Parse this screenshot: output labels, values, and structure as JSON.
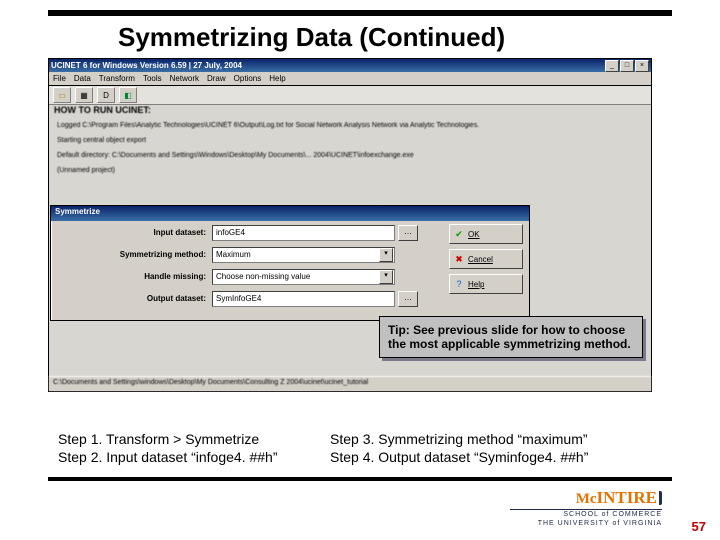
{
  "slide": {
    "title": "Symmetrizing Data (Continued)",
    "page_number": "57"
  },
  "app": {
    "title": "UCINET 6 for Windows    Version 6.59  |  27 July, 2004",
    "menus": [
      "File",
      "Data",
      "Transform",
      "Tools",
      "Network",
      "Draw",
      "Options",
      "Help"
    ],
    "header_line": "HOW TO RUN UCINET:",
    "fuzz_1": "Logged C:\\Program Files\\Analytic Technologies\\UCINET 6\\Output\\Log.txt for Social Network Analysis Network via Analytic Technologies.",
    "fuzz_2": "Starting central object export",
    "fuzz_3": "Default directory: C:\\Documents and Settings\\Windows\\Desktop\\My Documents\\... 2004\\UCINET\\infoexchange.exe",
    "fuzz_4": "(Unnamed project)",
    "status": "C:\\Documents and Settings\\windows\\Desktop\\My Documents\\Consulting Z 2004\\ucinet\\ucinet_tutorial"
  },
  "dialog": {
    "title": "Symmetrize",
    "labels": {
      "input": "Input dataset:",
      "method": "Symmetrizing method:",
      "missing": "Handle missing:",
      "output": "Output dataset:"
    },
    "values": {
      "input": "infoGE4",
      "method": "Maximum",
      "missing": "Choose non-missing value",
      "output": "SymInfoGE4"
    },
    "buttons": {
      "ok": "OK",
      "cancel": "Cancel",
      "help": "Help"
    },
    "browse": "…"
  },
  "tip": "Tip:  See previous slide for how to choose the most applicable symmetrizing method.",
  "steps": {
    "s1": "Step 1. Transform > Symmetrize",
    "s2": "Step 2. Input dataset “infoge4. ##h”",
    "s3": "Step 3. Symmetrizing method “maximum”",
    "s4": "Step 4. Output dataset “Syminfoge4. ##h”"
  },
  "logo": {
    "brand_a": "Mc",
    "brand_b": "INTIRE",
    "sub1": "SCHOOL of COMMERCE",
    "sub2": "THE UNIVERSITY of VIRGINIA"
  },
  "icons": {
    "min": "_",
    "max": "□",
    "close": "×",
    "drop": "▾",
    "ok": "✔",
    "cancel": "✖",
    "help": "?"
  }
}
